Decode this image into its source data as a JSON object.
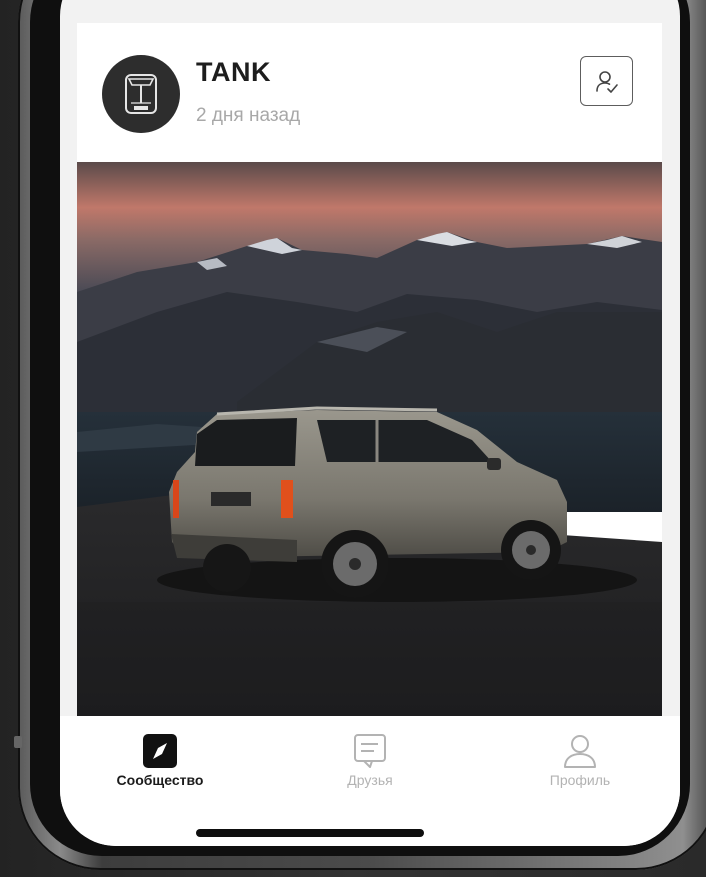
{
  "post": {
    "author": "TANK",
    "time": "2 дня назад",
    "avatar_icon": "tank-logo-icon",
    "follow_icon": "user-check-icon",
    "image_subject": "suv-mountain-photo"
  },
  "nav": {
    "items": [
      {
        "label": "Сообщество",
        "icon": "compass-icon",
        "active": true
      },
      {
        "label": "Друзья",
        "icon": "chat-icon",
        "active": false
      },
      {
        "label": "Профиль",
        "icon": "user-icon",
        "active": false
      }
    ]
  },
  "colors": {
    "active": "#1b1b1b",
    "inactive": "#b3b3b3",
    "avatar_bg": "#2d2d2d",
    "card_bg": "#ffffff",
    "screen_bg": "#f2f2f2"
  }
}
